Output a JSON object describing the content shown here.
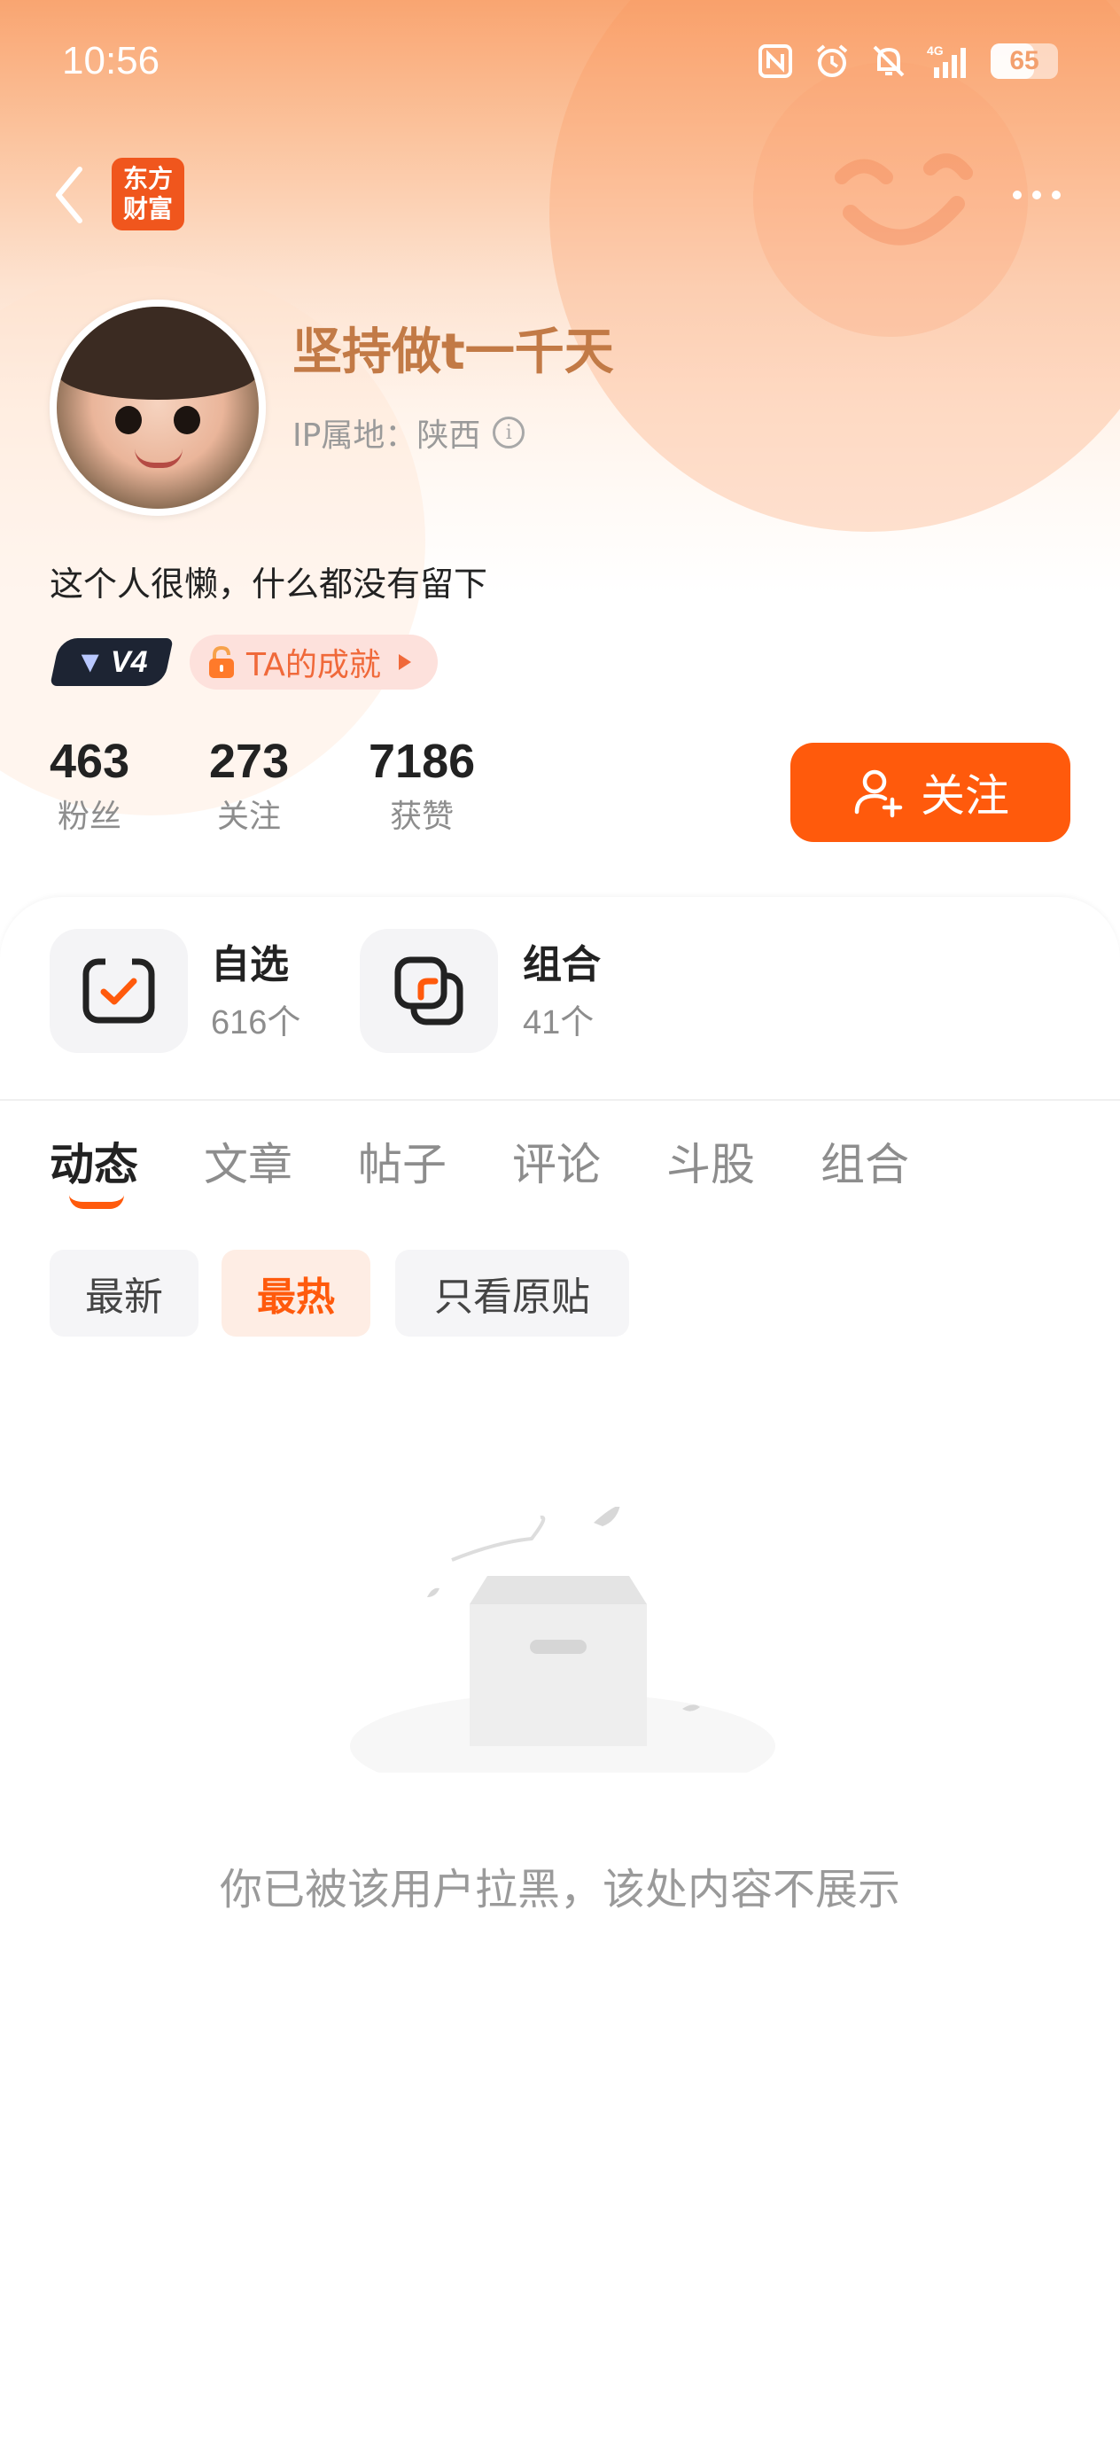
{
  "status_bar": {
    "time": "10:56",
    "battery": "65",
    "battery_fraction": 0.65,
    "icons": [
      "nfc-icon",
      "alarm-icon",
      "mute-bell-icon",
      "signal-4g-icon",
      "battery-icon"
    ]
  },
  "nav": {
    "logo_line1": "东方",
    "logo_line2": "财富"
  },
  "profile": {
    "username": "坚持做t一千天",
    "ip_label": "IP属地：陕西",
    "bio": "这个人很懒，什么都没有留下",
    "vip_level": "V4",
    "achievement_label": "TA的成就"
  },
  "stats": [
    {
      "value": "463",
      "label": "粉丝"
    },
    {
      "value": "273",
      "label": "关注"
    },
    {
      "value": "7186",
      "label": "获赞"
    }
  ],
  "follow_button": {
    "label": "关注"
  },
  "shortcuts": [
    {
      "title": "自选",
      "count": "616个"
    },
    {
      "title": "组合",
      "count": "41个"
    }
  ],
  "tabs": [
    "动态",
    "文章",
    "帖子",
    "评论",
    "斗股",
    "组合"
  ],
  "active_tab": "动态",
  "filters": [
    "最新",
    "最热",
    "只看原贴"
  ],
  "active_filter": "最热",
  "empty_message": "你已被该用户拉黑，该处内容不展示",
  "colors": {
    "accent": "#ff5a0c",
    "username": "#c27a46",
    "header_top": "#f9a571"
  }
}
